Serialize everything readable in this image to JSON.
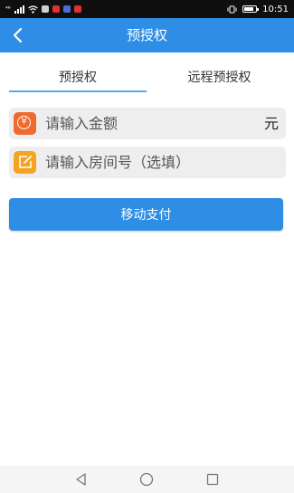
{
  "status_bar": {
    "carrier": "⁴⁶",
    "time": "10:51",
    "notif_colors": [
      "#e03030",
      "#4a6fd0",
      "#e03030"
    ]
  },
  "header": {
    "title": "预授权",
    "back_icon": "chevron-left-icon",
    "background": "#2e8ee6"
  },
  "tabs": [
    {
      "label": "预授权",
      "active": true
    },
    {
      "label": "远程预授权",
      "active": false
    }
  ],
  "form": {
    "amount": {
      "placeholder": "请输入金额",
      "value": "",
      "unit": "元",
      "icon": "yen-icon",
      "icon_glyph": "¥",
      "icon_color": "#ef6a2c"
    },
    "room": {
      "placeholder": "请输入房间号（选填）",
      "value": "",
      "icon": "edit-icon",
      "icon_color": "#f5a321"
    }
  },
  "pay_button": {
    "label": "移动支付",
    "color": "#2e8ee6"
  },
  "nav_bar": {
    "icons": [
      "back-triangle-icon",
      "home-circle-icon",
      "recents-square-icon"
    ]
  }
}
